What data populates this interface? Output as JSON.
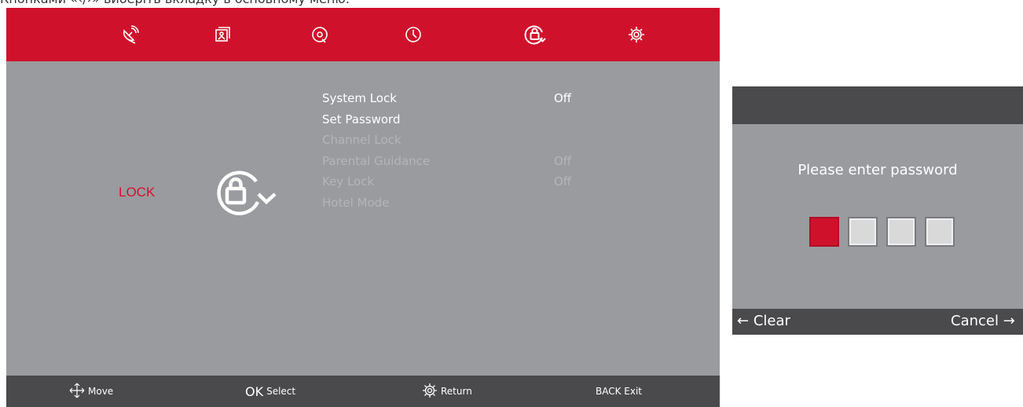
{
  "caption": "Кнопками «‹/›» виберіть вкладку в основному меню.",
  "colors": {
    "accent": "#d0112b",
    "panel": "#9a9b9f",
    "bar": "#4a4a4c"
  },
  "topbar": {
    "icons": [
      "satellite-dish-icon",
      "picture-icon",
      "disc-icon",
      "clock-icon",
      "lock-rotate-icon",
      "settings-gear-icon"
    ],
    "active": "lock-rotate-icon"
  },
  "category": {
    "label": "LOCK"
  },
  "menu": {
    "items": [
      {
        "label": "System Lock",
        "value": "Off",
        "enabled": true
      },
      {
        "label": "Set Password",
        "value": "",
        "enabled": true
      },
      {
        "label": "Channel Lock",
        "value": "",
        "enabled": false
      },
      {
        "label": "Parental Guidance",
        "value": "Off",
        "enabled": false
      },
      {
        "label": "Key Lock",
        "value": "Off",
        "enabled": false
      },
      {
        "label": "Hotel Mode",
        "value": "",
        "enabled": false
      }
    ]
  },
  "footer": {
    "move": "Move",
    "ok_key": "OK",
    "select": "Select",
    "return": "Return",
    "back_exit": "BACK Exit"
  },
  "password_dialog": {
    "prompt": "Please enter password",
    "digits_filled": 0,
    "digits_total": 4,
    "clear": "Clear",
    "cancel": "Cancel"
  }
}
